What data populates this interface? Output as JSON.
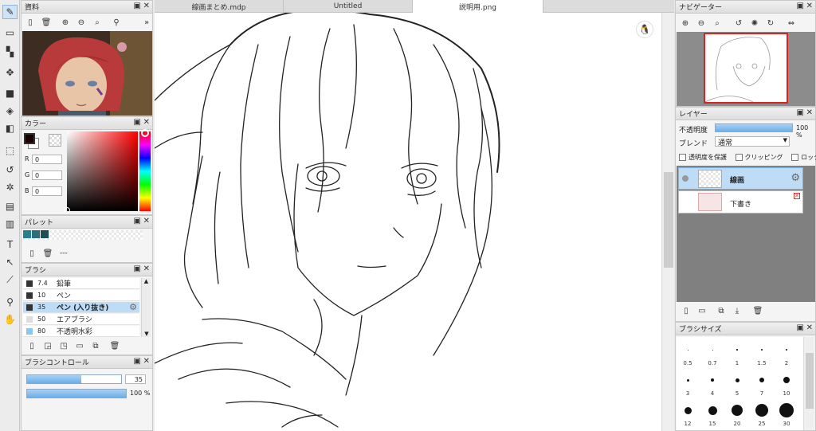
{
  "tabs": [
    {
      "label": "線画まとめ.mdp"
    },
    {
      "label": "Untitled"
    },
    {
      "label": "説明用.png"
    }
  ],
  "material": {
    "title": "資料",
    "nav_more": "»"
  },
  "color": {
    "title": "カラー",
    "r_label": "R",
    "r": "0",
    "g_label": "G",
    "g": "0",
    "b_label": "B",
    "b": "0",
    "fg": "#1a0000"
  },
  "palette": {
    "title": "パレット",
    "swatches": [
      "#2a7f8f",
      "#2b6d78",
      "#1f4d55"
    ],
    "dashes": "---"
  },
  "brush": {
    "title": "ブラシ",
    "items": [
      {
        "size": "7.4",
        "name": "鉛筆",
        "color": "#333333"
      },
      {
        "size": "10",
        "name": "ペン",
        "color": "#333333"
      },
      {
        "size": "35",
        "name": "ペン (入り抜き)",
        "color": "#333333",
        "selected": true
      },
      {
        "size": "50",
        "name": "エアブラシ",
        "color": "#dddddd"
      },
      {
        "size": "80",
        "name": "不透明水彩",
        "color": "#88c8e8"
      }
    ]
  },
  "brush_control": {
    "title": "ブラシコントロール",
    "size": "35",
    "opacity": "100 %",
    "size_level": 0.58,
    "opacity_level": 1.0
  },
  "navigator": {
    "title": "ナビゲーター"
  },
  "layer": {
    "title": "レイヤー",
    "opacity_label": "不透明度",
    "opacity_value": "100 %",
    "blend_label": "ブレンド",
    "blend_value": "通常",
    "protect_label": "透明度を保護",
    "clip_label": "クリッピング",
    "lock_label": "ロック",
    "layers": [
      {
        "name": "線画",
        "selected": true
      },
      {
        "name": "下書き",
        "selected": false
      }
    ]
  },
  "brush_size": {
    "title": "ブラシサイズ",
    "sizes": [
      "0.5",
      "0.7",
      "1",
      "1.5",
      "2",
      "3",
      "4",
      "5",
      "7",
      "10",
      "12",
      "15",
      "20",
      "25",
      "30"
    ]
  }
}
